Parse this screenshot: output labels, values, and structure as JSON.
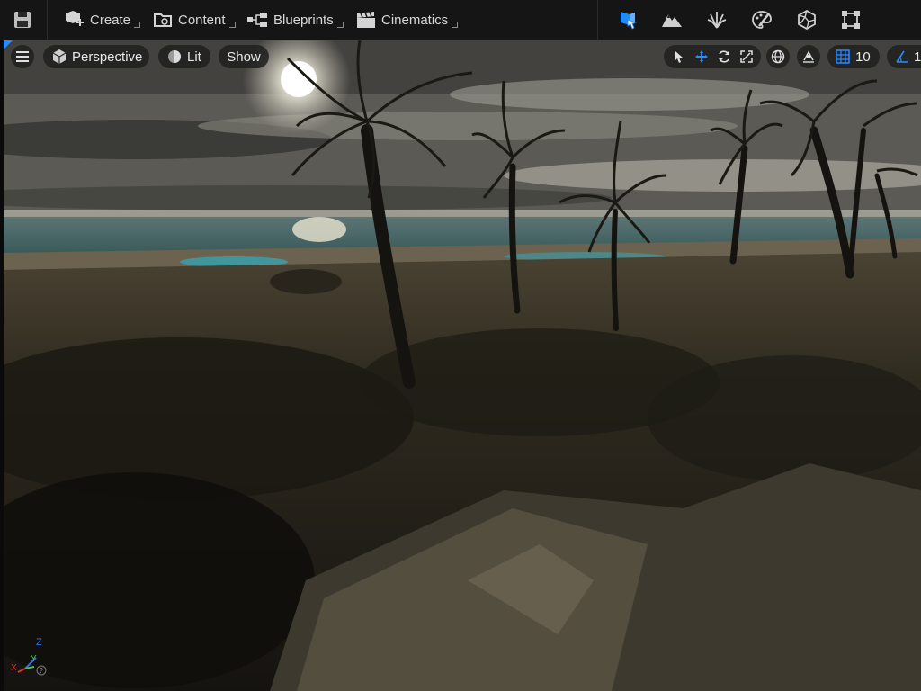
{
  "toolbar": {
    "create_label": "Create",
    "content_label": "Content",
    "blueprints_label": "Blueprints",
    "cinematics_label": "Cinematics",
    "modes": [
      "select-mode-icon",
      "landscape-mode-icon",
      "foliage-mode-icon",
      "mesh-paint-mode-icon",
      "fracture-mode-icon",
      "modeling-mode-icon"
    ]
  },
  "viewport": {
    "perspective_label": "Perspective",
    "lit_label": "Lit",
    "show_label": "Show",
    "grid_snap_value": "10",
    "rotation_snap_value": "1"
  },
  "colors": {
    "accent": "#2a8cff",
    "toolbar_bg": "#151515"
  }
}
